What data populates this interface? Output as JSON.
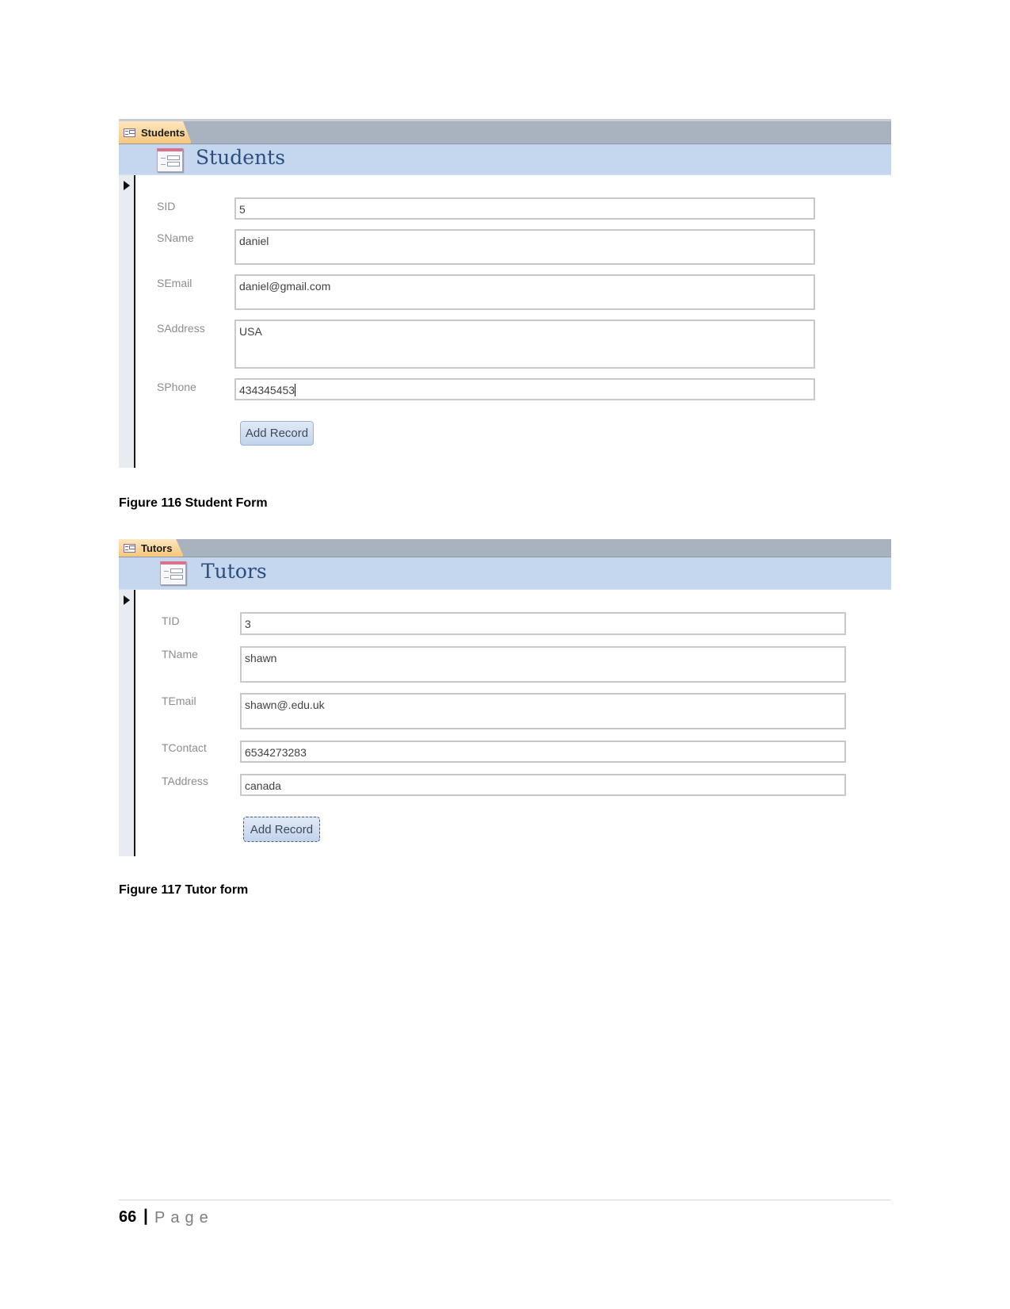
{
  "figures": [
    {
      "tab_label": "Students",
      "form_title": "Students",
      "fields": [
        {
          "label": "SID",
          "value": "5"
        },
        {
          "label": "SName",
          "value": "daniel"
        },
        {
          "label": "SEmail",
          "value": "daniel@gmail.com"
        },
        {
          "label": "SAddress",
          "value": "USA"
        },
        {
          "label": "SPhone",
          "value": "434345453"
        }
      ],
      "button_label": "Add Record",
      "caption": "Figure 116 Student Form"
    },
    {
      "tab_label": "Tutors",
      "form_title": "Tutors",
      "fields": [
        {
          "label": "TID",
          "value": "3"
        },
        {
          "label": "TName",
          "value": "shawn"
        },
        {
          "label": "TEmail",
          "value": "shawn@.edu.uk"
        },
        {
          "label": "TContact",
          "value": "6534273283"
        },
        {
          "label": "TAddress",
          "value": "canada"
        }
      ],
      "button_label": "Add Record",
      "caption": "Figure 117 Tutor form"
    }
  ],
  "footer": {
    "page_number": "66",
    "separator": "|",
    "page_word": "Page"
  },
  "colors": {
    "header_band": "#c5d7ee",
    "tab_bar": "#a9b3bf",
    "title_text": "#2c4e7f",
    "tab_active": "#f6c77c"
  }
}
